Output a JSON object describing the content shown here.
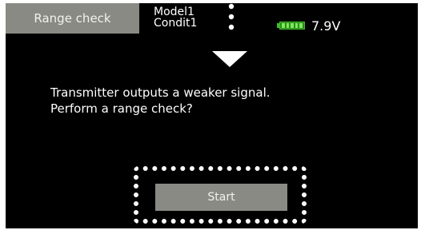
{
  "header": {
    "screen_title": "Range check",
    "model_name": "Model1",
    "condition_name": "Condit1",
    "battery_voltage": "7.9V"
  },
  "main": {
    "message_line1": "Transmitter outputs a weaker signal.",
    "message_line2": "Perform a range check?",
    "start_label": "Start"
  },
  "icons": {
    "battery": "battery-icon",
    "arrow": "arrow-down-icon"
  },
  "colors": {
    "background": "#000000",
    "button_gray": "#8a8a84",
    "battery_green": "#3fbf2a",
    "text": "#ffffff"
  }
}
